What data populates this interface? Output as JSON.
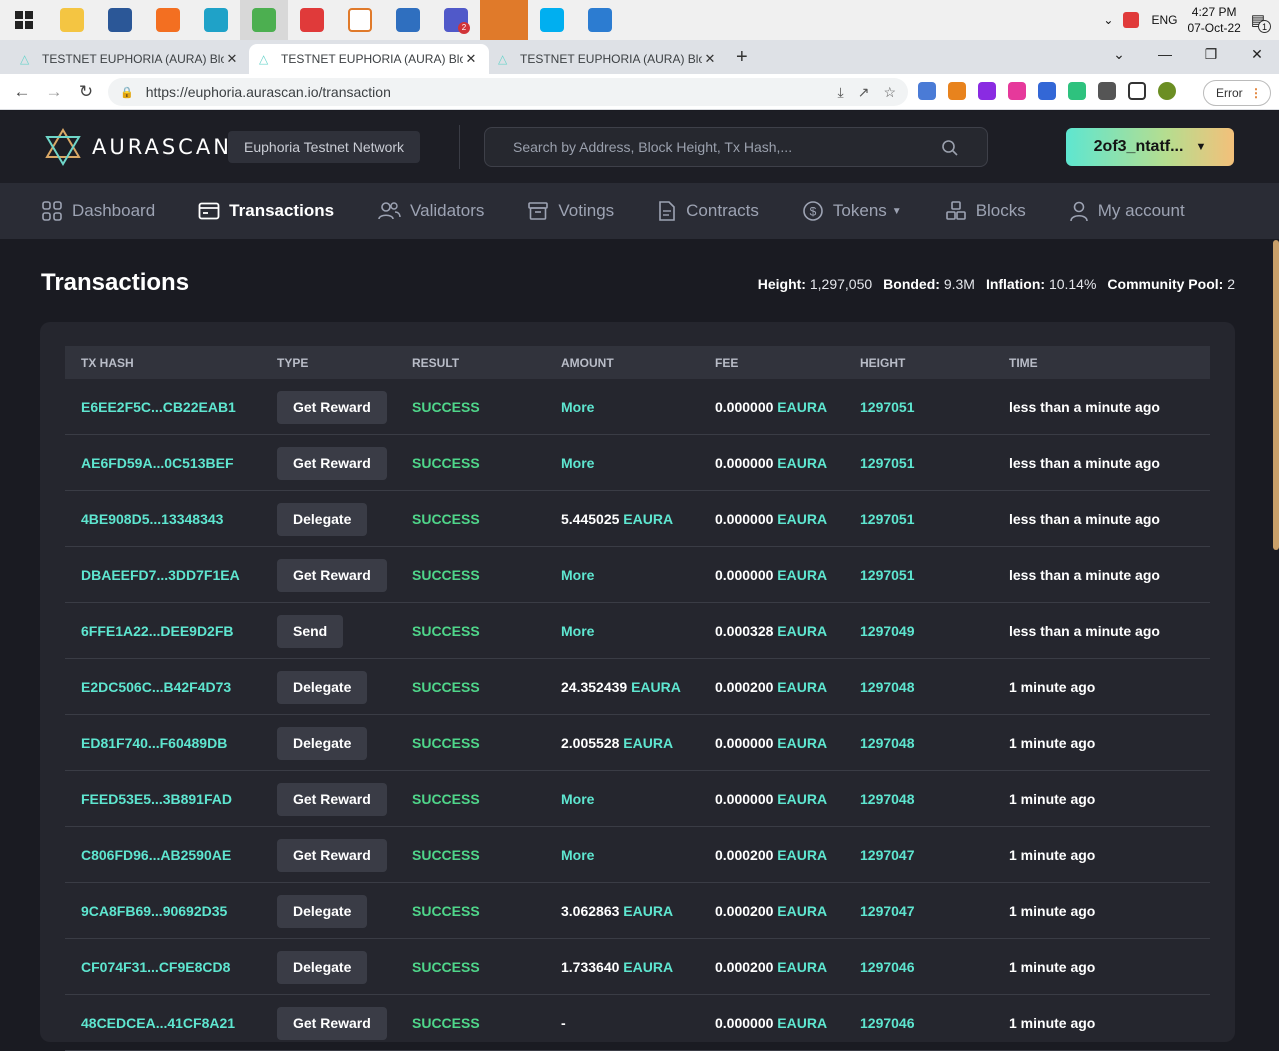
{
  "taskbar": {
    "apps": [
      {
        "name": "file-explorer",
        "color": "#f4c542"
      },
      {
        "name": "app-blue",
        "color": "#2b5797"
      },
      {
        "name": "app-orange",
        "color": "#f36f21"
      },
      {
        "name": "edge",
        "color": "#1fa2c8"
      },
      {
        "name": "chrome",
        "color": "#4caf50"
      },
      {
        "name": "app-red",
        "color": "#e03a3a"
      },
      {
        "name": "app-white",
        "color": "#ffffff"
      },
      {
        "name": "sourcetree",
        "color": "#2f6fbf"
      },
      {
        "name": "teams",
        "color": "#5059c9",
        "badge": "2"
      },
      {
        "name": "app-blocks",
        "color": "#e07a2a"
      },
      {
        "name": "skype",
        "color": "#00aff0"
      },
      {
        "name": "mail",
        "color": "#2c7cd1"
      }
    ],
    "lang": "ENG",
    "time": "4:27 PM",
    "date": "07-Oct-22",
    "notification_count": "1"
  },
  "browser": {
    "tabs": [
      {
        "title": "TESTNET EUPHORIA (AURA) Bloc",
        "active": false
      },
      {
        "title": "TESTNET EUPHORIA (AURA) Bloc",
        "active": true
      },
      {
        "title": "TESTNET EUPHORIA (AURA) Bloc",
        "active": false
      }
    ],
    "url": "https://euphoria.aurascan.io/transaction",
    "error_label": "Error"
  },
  "header": {
    "logo_text": "AURASCAN",
    "network": "Euphoria Testnet Network",
    "search_placeholder": "Search by Address, Block Height, Tx Hash,...",
    "wallet": "2of3_ntatf..."
  },
  "nav": {
    "items": [
      {
        "label": "Dashboard",
        "icon": "grid-icon"
      },
      {
        "label": "Transactions",
        "icon": "wallet-icon",
        "active": true
      },
      {
        "label": "Validators",
        "icon": "users-icon"
      },
      {
        "label": "Votings",
        "icon": "archive-icon"
      },
      {
        "label": "Contracts",
        "icon": "document-icon"
      },
      {
        "label": "Tokens",
        "icon": "dollar-icon",
        "dropdown": true
      },
      {
        "label": "Blocks",
        "icon": "blocks-icon"
      },
      {
        "label": "My account",
        "icon": "user-icon"
      }
    ]
  },
  "page": {
    "title": "Transactions",
    "stats": {
      "height_label": "Height:",
      "height": "1,297,050",
      "bonded_label": "Bonded:",
      "bonded": "9.3M",
      "inflation_label": "Inflation:",
      "inflation": "10.14%",
      "pool_label": "Community Pool:",
      "pool": "2"
    }
  },
  "table": {
    "columns": [
      "TX HASH",
      "TYPE",
      "RESULT",
      "AMOUNT",
      "FEE",
      "HEIGHT",
      "TIME"
    ],
    "rows": [
      {
        "hash": "E6EE2F5C...CB22EAB1",
        "type": "Get Reward",
        "result": "SUCCESS",
        "amount": "More",
        "amount_denom": "",
        "fee": "0.000000",
        "fee_denom": "EAURA",
        "height": "1297051",
        "time": "less than a minute ago"
      },
      {
        "hash": "AE6FD59A...0C513BEF",
        "type": "Get Reward",
        "result": "SUCCESS",
        "amount": "More",
        "amount_denom": "",
        "fee": "0.000000",
        "fee_denom": "EAURA",
        "height": "1297051",
        "time": "less than a minute ago"
      },
      {
        "hash": "4BE908D5...13348343",
        "type": "Delegate",
        "result": "SUCCESS",
        "amount": "5.445025",
        "amount_denom": "EAURA",
        "fee": "0.000000",
        "fee_denom": "EAURA",
        "height": "1297051",
        "time": "less than a minute ago"
      },
      {
        "hash": "DBAEEFD7...3DD7F1EA",
        "type": "Get Reward",
        "result": "SUCCESS",
        "amount": "More",
        "amount_denom": "",
        "fee": "0.000000",
        "fee_denom": "EAURA",
        "height": "1297051",
        "time": "less than a minute ago"
      },
      {
        "hash": "6FFE1A22...DEE9D2FB",
        "type": "Send",
        "result": "SUCCESS",
        "amount": "More",
        "amount_denom": "",
        "fee": "0.000328",
        "fee_denom": "EAURA",
        "height": "1297049",
        "time": "less than a minute ago"
      },
      {
        "hash": "E2DC506C...B42F4D73",
        "type": "Delegate",
        "result": "SUCCESS",
        "amount": "24.352439",
        "amount_denom": "EAURA",
        "fee": "0.000200",
        "fee_denom": "EAURA",
        "height": "1297048",
        "time": "1 minute ago"
      },
      {
        "hash": "ED81F740...F60489DB",
        "type": "Delegate",
        "result": "SUCCESS",
        "amount": "2.005528",
        "amount_denom": "EAURA",
        "fee": "0.000000",
        "fee_denom": "EAURA",
        "height": "1297048",
        "time": "1 minute ago"
      },
      {
        "hash": "FEED53E5...3B891FAD",
        "type": "Get Reward",
        "result": "SUCCESS",
        "amount": "More",
        "amount_denom": "",
        "fee": "0.000000",
        "fee_denom": "EAURA",
        "height": "1297048",
        "time": "1 minute ago"
      },
      {
        "hash": "C806FD96...AB2590AE",
        "type": "Get Reward",
        "result": "SUCCESS",
        "amount": "More",
        "amount_denom": "",
        "fee": "0.000200",
        "fee_denom": "EAURA",
        "height": "1297047",
        "time": "1 minute ago"
      },
      {
        "hash": "9CA8FB69...90692D35",
        "type": "Delegate",
        "result": "SUCCESS",
        "amount": "3.062863",
        "amount_denom": "EAURA",
        "fee": "0.000200",
        "fee_denom": "EAURA",
        "height": "1297047",
        "time": "1 minute ago"
      },
      {
        "hash": "CF074F31...CF9E8CD8",
        "type": "Delegate",
        "result": "SUCCESS",
        "amount": "1.733640",
        "amount_denom": "EAURA",
        "fee": "0.000200",
        "fee_denom": "EAURA",
        "height": "1297046",
        "time": "1 minute ago"
      },
      {
        "hash": "48CEDCEA...41CF8A21",
        "type": "Get Reward",
        "result": "SUCCESS",
        "amount": "-",
        "amount_denom": "",
        "fee": "0.000000",
        "fee_denom": "EAURA",
        "height": "1297046",
        "time": "1 minute ago"
      }
    ]
  }
}
